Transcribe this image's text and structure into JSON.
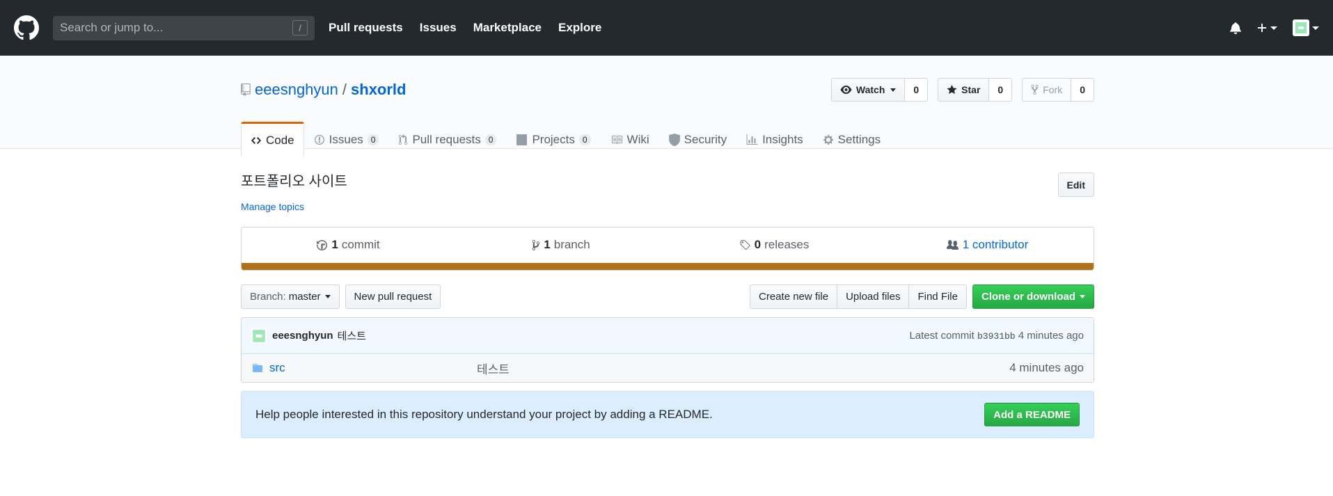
{
  "header": {
    "search_placeholder": "Search or jump to...",
    "search_shortcut": "/",
    "nav": [
      "Pull requests",
      "Issues",
      "Marketplace",
      "Explore"
    ]
  },
  "repo": {
    "owner": "eeesnghyun",
    "separator": "/",
    "name": "shxorld",
    "watch_label": "Watch",
    "watch_count": "0",
    "star_label": "Star",
    "star_count": "0",
    "fork_label": "Fork",
    "fork_count": "0"
  },
  "tabs": [
    {
      "label": "Code",
      "counter": ""
    },
    {
      "label": "Issues",
      "counter": "0"
    },
    {
      "label": "Pull requests",
      "counter": "0"
    },
    {
      "label": "Projects",
      "counter": "0"
    },
    {
      "label": "Wiki",
      "counter": ""
    },
    {
      "label": "Security",
      "counter": ""
    },
    {
      "label": "Insights",
      "counter": ""
    },
    {
      "label": "Settings",
      "counter": ""
    }
  ],
  "description": {
    "text": "포트폴리오 사이트",
    "edit_label": "Edit",
    "topics_label": "Manage topics"
  },
  "summary": {
    "commits_num": "1",
    "commits_label": "commit",
    "branches_num": "1",
    "branches_label": "branch",
    "releases_num": "0",
    "releases_label": "releases",
    "contributors_label": "1 contributor",
    "lang_color": "#b07219"
  },
  "file_nav": {
    "branch_prefix": "Branch:",
    "branch_name": "master",
    "new_pr": "New pull request",
    "create_file": "Create new file",
    "upload_files": "Upload files",
    "find_file": "Find File",
    "clone": "Clone or download"
  },
  "commit": {
    "author": "eeesnghyun",
    "message": "테스트",
    "latest_label": "Latest commit",
    "sha": "b3931bb",
    "age": "4 minutes ago"
  },
  "files": [
    {
      "name": "src",
      "message": "테스트",
      "age": "4 minutes ago"
    }
  ],
  "readme": {
    "text": "Help people interested in this repository understand your project by adding a README.",
    "button": "Add a README"
  }
}
